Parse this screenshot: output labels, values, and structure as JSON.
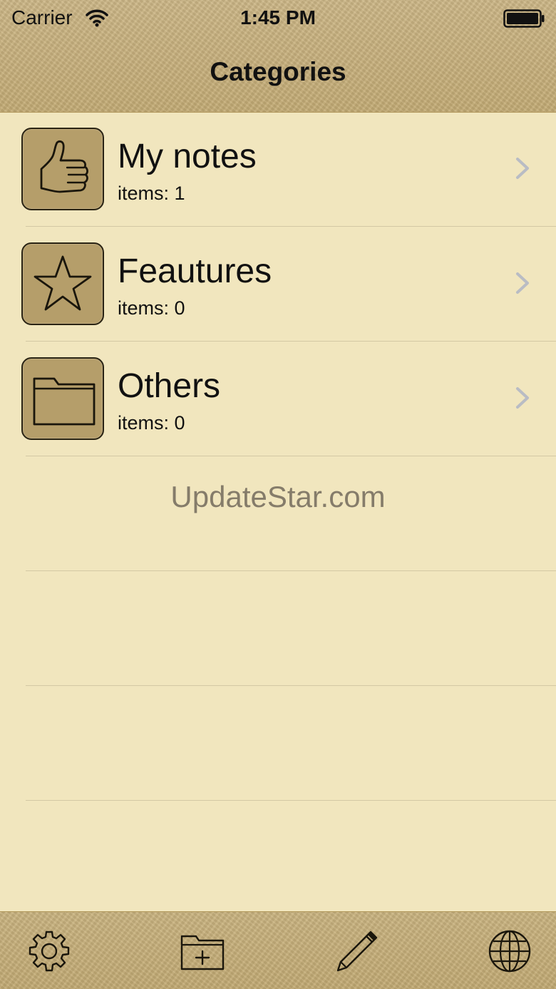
{
  "status_bar": {
    "carrier": "Carrier",
    "time": "1:45 PM"
  },
  "nav": {
    "title": "Categories"
  },
  "categories": [
    {
      "title": "My notes",
      "subtitle": "items: 1",
      "icon": "thumbs-up-icon"
    },
    {
      "title": "Feautures",
      "subtitle": "items: 0",
      "icon": "star-icon"
    },
    {
      "title": "Others",
      "subtitle": "items: 0",
      "icon": "folder-icon"
    }
  ],
  "watermark": "UpdateStar.com",
  "toolbar": {
    "items": [
      "gear-icon",
      "new-folder-icon",
      "pencil-icon",
      "globe-icon"
    ]
  },
  "colors": {
    "background": "#f1e6be",
    "leather": "#c9b27d",
    "icon_fill": "#b59e6a",
    "chevron": "#b9bcc4"
  }
}
